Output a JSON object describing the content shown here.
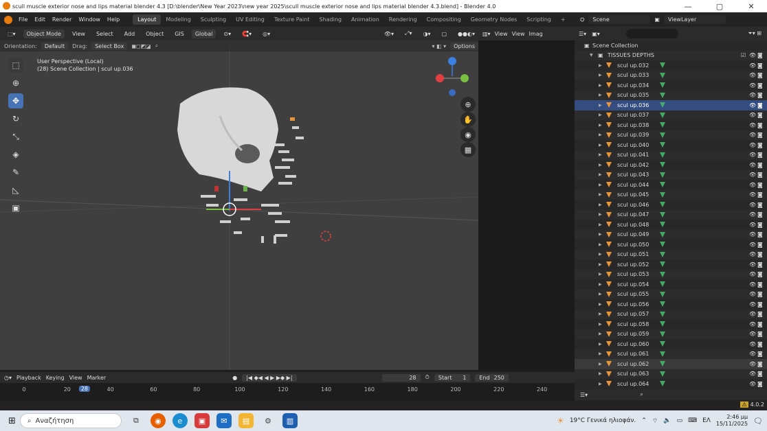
{
  "window": {
    "title": "scull muscle exterior nose and lips material blender 4.3 [D:\\blender\\New Year 2023\\new year 2025\\scull muscle exterior nose and lips material blender 4.3.blend] - Blender 4.0",
    "min": "—",
    "max": "▢",
    "close": "✕"
  },
  "menu": {
    "items": [
      "File",
      "Edit",
      "Render",
      "Window",
      "Help"
    ],
    "workspaces": [
      "Layout",
      "Modeling",
      "Sculpting",
      "UV Editing",
      "Texture Paint",
      "Shading",
      "Animation",
      "Rendering",
      "Compositing",
      "Geometry Nodes",
      "Scripting"
    ],
    "active_workspace": "Layout",
    "add": "+"
  },
  "scene": {
    "label": "Scene",
    "view_layer": "ViewLayer"
  },
  "viewport_header": {
    "mode": "Object Mode",
    "view": "View",
    "select": "Select",
    "add": "Add",
    "object": "Object",
    "gis": "GIS",
    "orientation_global": "Global"
  },
  "viewport_tool": {
    "orientation_label": "Orientation:",
    "orientation": "Default",
    "drag_label": "Drag:",
    "drag": "Select Box",
    "options": "Options"
  },
  "viewport_info": {
    "perspective": "User Perspective (Local)",
    "collection": "(28) Scene Collection | scul up.036"
  },
  "midpanel": {
    "view1": "View",
    "view2": "View",
    "image": "Imag"
  },
  "outliner": {
    "search_placeholder": "",
    "root": "Scene Collection",
    "collection": "TISSUES DEPTHS",
    "selected": "scul up.036",
    "items": [
      "scul up.032",
      "scul up.033",
      "scul up.034",
      "scul up.035",
      "scul up.036",
      "scul up.037",
      "scul up.038",
      "scul up.039",
      "scul up.040",
      "scul up.041",
      "scul up.042",
      "scul up.043",
      "scul up.044",
      "scul up.045",
      "scul up.046",
      "scul up.047",
      "scul up.048",
      "scul up.049",
      "scul up.050",
      "scul up.051",
      "scul up.052",
      "scul up.053",
      "scul up.054",
      "scul up.055",
      "scul up.056",
      "scul up.057",
      "scul up.058",
      "scul up.059",
      "scul up.060",
      "scul up.061",
      "scul up.062",
      "scul up.063",
      "scul up.064"
    ]
  },
  "timeline": {
    "playback": "Playback",
    "keying": "Keying",
    "view": "View",
    "marker": "Marker",
    "current_frame": "28",
    "start_label": "Start",
    "start": "1",
    "end_label": "End",
    "end": "250",
    "ticks": [
      "0",
      "20",
      "40",
      "60",
      "80",
      "100",
      "120",
      "140",
      "160",
      "180",
      "200",
      "220",
      "240"
    ]
  },
  "version": "4.0.2",
  "taskbar": {
    "search": "Αναζήτηση",
    "weather": "19°C Γενικά ηλιοφάν.",
    "lang": "ΕΛ",
    "time": "2:46 μμ",
    "date": "15/11/2025"
  }
}
